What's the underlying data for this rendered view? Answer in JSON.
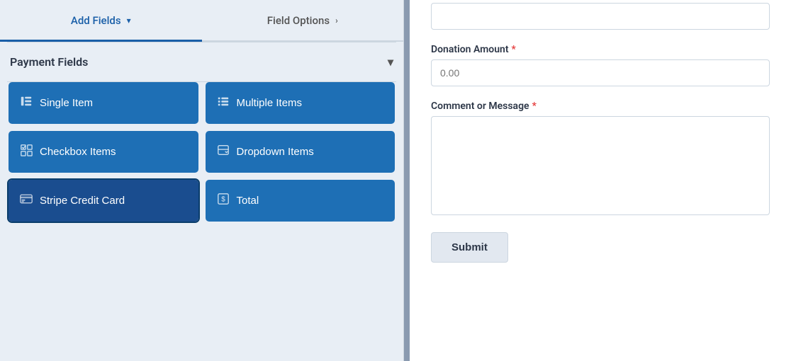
{
  "tabs": [
    {
      "id": "add-fields",
      "label": "Add Fields",
      "chevron": "▾",
      "active": true
    },
    {
      "id": "field-options",
      "label": "Field Options",
      "chevron": "›",
      "active": false
    }
  ],
  "payment_section": {
    "label": "Payment Fields",
    "chevron": "▾"
  },
  "field_buttons": [
    {
      "id": "single-item",
      "label": "Single Item",
      "icon": "📄"
    },
    {
      "id": "multiple-items",
      "label": "Multiple Items",
      "icon": "☰"
    },
    {
      "id": "checkbox-items",
      "label": "Checkbox Items",
      "icon": "☑"
    },
    {
      "id": "dropdown-items",
      "label": "Dropdown Items",
      "icon": "⊟"
    },
    {
      "id": "stripe-credit-card",
      "label": "Stripe Credit Card",
      "icon": "💳",
      "active": true
    },
    {
      "id": "total",
      "label": "Total",
      "icon": "💲"
    }
  ],
  "right_panel": {
    "top_input_placeholder": "",
    "donation_amount": {
      "label": "Donation Amount",
      "required": true,
      "placeholder": "0.00"
    },
    "comment_message": {
      "label": "Comment or Message",
      "required": true,
      "placeholder": ""
    },
    "submit_button_label": "Submit"
  }
}
